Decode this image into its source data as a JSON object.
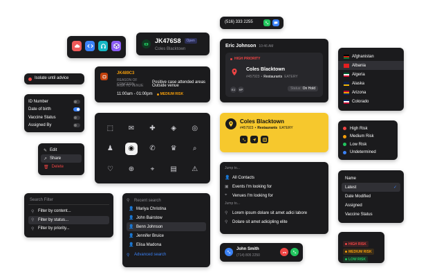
{
  "app_icons": {
    "colors": [
      "#ef5a5a",
      "#3b82f6",
      "#14b8c4",
      "#8b5cf6"
    ],
    "names": [
      "cloud-icon",
      "code-icon",
      "headphones-icon",
      "package-icon"
    ]
  },
  "plate": {
    "title": "JK476S8",
    "subtitle": "Coles Blacktown",
    "badge": "Open"
  },
  "phone_chip": {
    "number": "(516) 333 2255"
  },
  "isolate": {
    "label": "Isolate until advice"
  },
  "case": {
    "id": "JK489C3",
    "reason_label": "REASON OF CONCERN",
    "reason_value": "Positive case attended areas",
    "risk_label": "RISK TO VENUE",
    "risk_value": "Outside venue",
    "time": "11:00am - 01:00pm",
    "risk_badge": "MEDIUM RISK"
  },
  "chat": {
    "name": "Eric Johnson",
    "time": "10:46 AM",
    "priority": "HIGH PRIORITY",
    "venue": "Coles Blacktown",
    "venue_id": "#457923",
    "venue_cat": "Restaurants",
    "venue_type": "EATERY",
    "avatars": [
      "EJ",
      "KP"
    ],
    "status_label": "Status:",
    "status_value": "On Hold"
  },
  "countries": [
    {
      "name": "Afghanistan",
      "selected": false
    },
    {
      "name": "Albania",
      "selected": true
    },
    {
      "name": "Algeria",
      "selected": false
    },
    {
      "name": "Alaska",
      "selected": false
    },
    {
      "name": "Arizona",
      "selected": false
    },
    {
      "name": "Colorado",
      "selected": false
    }
  ],
  "settings": [
    {
      "label": "ID Number",
      "on": false
    },
    {
      "label": "Date of birth",
      "on": true
    },
    {
      "label": "Vaccine Status",
      "on": false
    },
    {
      "label": "Assigned By",
      "on": false
    }
  ],
  "context_menu": {
    "edit": "Edit",
    "share": "Share",
    "delete": "Delete"
  },
  "icon_grid": [
    "box-icon",
    "mail-icon",
    "first-aid-icon",
    "bag-icon",
    "coin-icon",
    "user-icon",
    "chef-hat-icon",
    "phone-icon",
    "crown-icon",
    "search-icon",
    "heart-icon",
    "plus-circle-icon",
    "location-icon",
    "document-icon",
    "warning-icon"
  ],
  "venue_card": {
    "name": "Coles Blacktown",
    "id": "#457923",
    "cat": "Restaurants",
    "type": "EATERY"
  },
  "risk_legend": [
    {
      "label": "High Risk",
      "color": "#ef4444"
    },
    {
      "label": "Medium Risk",
      "color": "#f59e0b"
    },
    {
      "label": "Low Risk",
      "color": "#22c55e"
    },
    {
      "label": "Undetermined",
      "color": "#3b82f6"
    }
  ],
  "jump": {
    "header1": "Jump to...",
    "items1": [
      "All Contacts",
      "Events I'm looking for",
      "Venues I'm looking for"
    ],
    "header2": "Jump to...",
    "items2": [
      "Lorem ipsum dolare sit amet adici labore",
      "Dolare sit amet adicipling elite"
    ]
  },
  "sort_menu": {
    "items": [
      "Name",
      "Latest",
      "Date Modified",
      "Assigned",
      "Vaccine Status"
    ],
    "selected": 1
  },
  "search_filter": {
    "placeholder": "Search Filter",
    "items": [
      "Filter by content...",
      "Filter by status...",
      "Filter by priority..."
    ],
    "active": 1
  },
  "recent": {
    "header": "Recent search",
    "items": [
      "Mariya Christina",
      "John Bairstow",
      "Benn Johnson",
      "Jennifer Bruice",
      "Elisa Madona"
    ],
    "active": 2,
    "advanced": "Advanced search"
  },
  "call": {
    "name": "John Smith",
    "number": "(714) 805 2250"
  },
  "risk_pills": [
    {
      "label": "HIGH RISK",
      "color": "#ef4444"
    },
    {
      "label": "MEDIUM RISK",
      "color": "#f59e0b"
    },
    {
      "label": "LOW RISK",
      "color": "#22c55e"
    }
  ]
}
